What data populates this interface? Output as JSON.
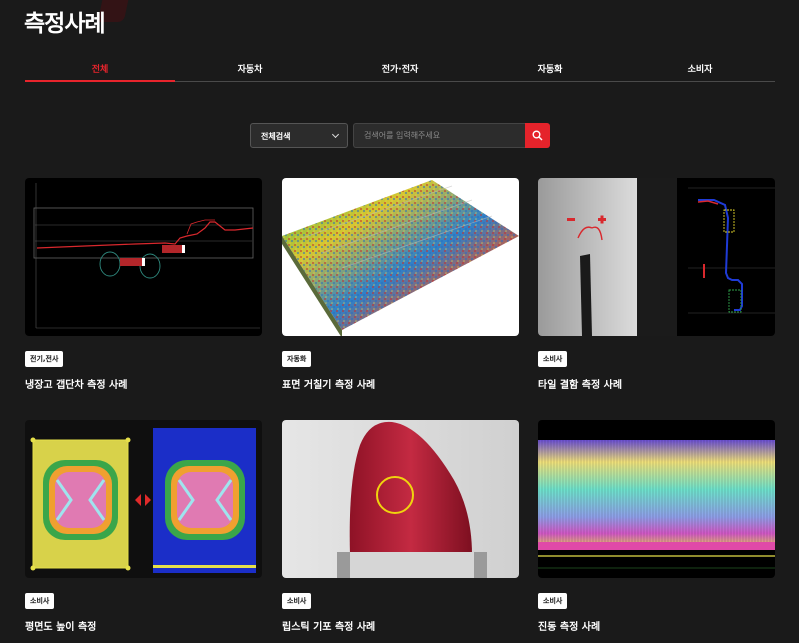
{
  "header": {
    "title": "측정사례"
  },
  "tabs": [
    {
      "label": "전체",
      "active": true
    },
    {
      "label": "자동차"
    },
    {
      "label": "전가·전자"
    },
    {
      "label": "자동화"
    },
    {
      "label": "소비자"
    }
  ],
  "search": {
    "select_value": "전체검색",
    "placeholder": "검색어를 입력해주세요",
    "button_icon": "search-icon"
  },
  "colors": {
    "accent": "#e5232b",
    "background": "#1a1a1a"
  },
  "cards": [
    {
      "badge": "전기,전사",
      "title": "냉장고 갭단차 측정 사례"
    },
    {
      "badge": "자동화",
      "title": "표면 거칠기 측정 사례"
    },
    {
      "badge": "소비사",
      "title": "타일 결함 측정 사례"
    },
    {
      "badge": "소비사",
      "title": "평면도 높이 측정"
    },
    {
      "badge": "소비사",
      "title": "립스틱 기포 측정 사례"
    },
    {
      "badge": "소비사",
      "title": "진동 측정 사례"
    }
  ]
}
